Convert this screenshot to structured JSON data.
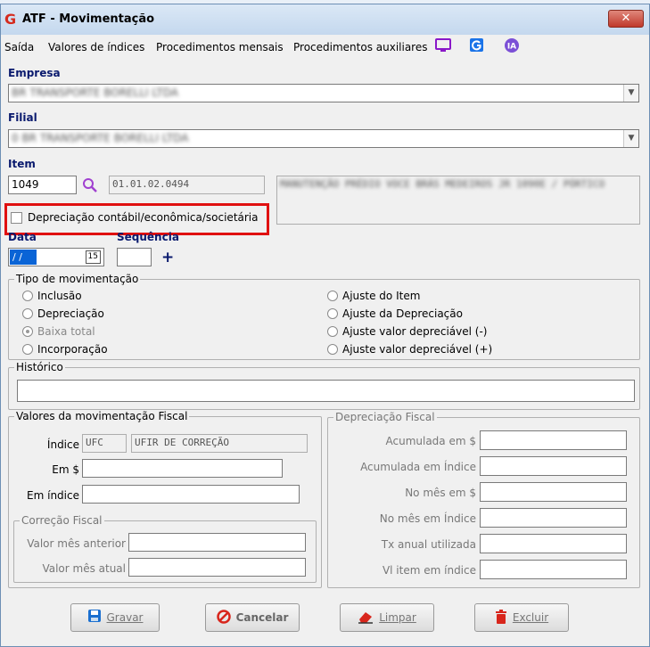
{
  "window": {
    "title": "ATF - Movimentação",
    "close_label": "✕"
  },
  "menu": {
    "items": [
      "Saída",
      "Valores de índices",
      "Procedimentos mensais",
      "Procedimentos auxiliares"
    ],
    "icons": [
      "monitor-icon",
      "g-app-icon",
      "ia-icon"
    ],
    "ia_label": "IA",
    "g_label": "G"
  },
  "empresa": {
    "label": "Empresa",
    "value": "BR TRANSPORTE BORELLI LTDA"
  },
  "filial": {
    "label": "Filial",
    "value": "0 BR TRANSPORTE BORELLI LTDA"
  },
  "item": {
    "label": "Item",
    "code": "1049",
    "account": "01.01.02.0494",
    "description": "MANUTENÇÃO PRÉDIO VOCE BRÁS MEDEIROS JR 1090E / PÓRTICO"
  },
  "depreciacao_check": {
    "label": "Depreciação contábil/econômica/societária",
    "checked": false
  },
  "data": {
    "label": "Data",
    "value": "/ /",
    "calendar": "15"
  },
  "sequencia": {
    "label": "Sequência",
    "value": "",
    "add": "+"
  },
  "tipo": {
    "title": "Tipo de movimentação",
    "left": [
      "Inclusão",
      "Depreciação",
      "Baixa total",
      "Incorporação"
    ],
    "right": [
      "Ajuste do Item",
      "Ajuste da Depreciação",
      "Ajuste valor depreciável (-)",
      "Ajuste valor depreciável (+)"
    ]
  },
  "historico": {
    "title": "Histórico",
    "value": ""
  },
  "valores": {
    "title": "Valores da movimentação Fiscal",
    "indice_label": "Índice",
    "indice_code": "UFC",
    "indice_name": "UFIR DE CORREÇÃO",
    "em_label": "Em $",
    "em_indice_label": "Em índice"
  },
  "correcao": {
    "title": "Correção Fiscal",
    "anterior_label": "Valor mês anterior",
    "atual_label": "Valor mês atual"
  },
  "depreciacao_fiscal": {
    "title": "Depreciação Fiscal",
    "labels": [
      "Acumulada em $",
      "Acumulada em Índice",
      "No mês em $",
      "No mês em Índice",
      "Tx anual utilizada",
      "Vl item em índice"
    ]
  },
  "buttons": {
    "gravar": "Gravar",
    "cancelar": "Cancelar",
    "limpar": "Limpar",
    "excluir": "Excluir"
  },
  "colors": {
    "accent": "#0a1a6e",
    "highlight": "#e01010",
    "ia": "#7b4fd6",
    "g": "#1a73e8"
  }
}
